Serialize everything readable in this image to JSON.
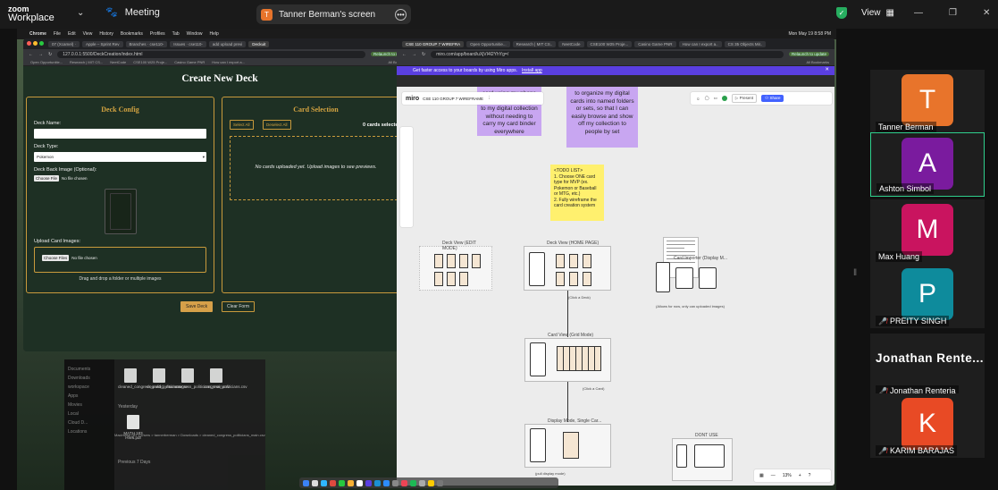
{
  "zoom": {
    "brand_line1": "zoom",
    "brand_line2": "Workplace",
    "meeting_label": "Meeting",
    "screen_share_label": "Tanner Berman's screen",
    "presenter_initial": "T",
    "view_label": "View"
  },
  "mac_menu": [
    "Chrome",
    "File",
    "Edit",
    "View",
    "History",
    "Bookmarks",
    "Profiles",
    "Tab",
    "Window",
    "Help"
  ],
  "mac_clock": "Mon May 19  8:58 PM",
  "chrome_left": {
    "tabs": [
      "07 (Xcamel) ·",
      "Apple – Sprint Rev",
      "Branches · cse110-",
      "Issues · cse110-",
      "add upload previ",
      "Deckuit"
    ],
    "url": "127.0.0.1:5500/DeckCreation/index.html",
    "relaunch": "Relaunch to update",
    "bookmarks": [
      "Open Opportunitie...",
      "Research | MIT CS...",
      "NeetCode",
      "CSE100 W25 Proje...",
      "Casino Game PNR",
      "How can I export a..."
    ],
    "all_bookmarks": "All Bookmarks"
  },
  "deck_app": {
    "title": "Create New Deck",
    "config": {
      "heading": "Deck Config",
      "name_label": "Deck Name:",
      "type_label": "Deck Type:",
      "type_value": "Pokemon",
      "back_label": "Deck Back Image (Optional):",
      "choose_file": "Choose File",
      "no_file": "No file chosen",
      "upload_label": "Upload Card Images:",
      "choose_files": "Choose Files",
      "no_file2": "No file chosen",
      "drop_hint": "Drag and drop a folder or multiple images"
    },
    "selection": {
      "heading": "Card Selection",
      "select_all": "Select All",
      "deselect_all": "Deselect All",
      "count": "0 cards selected",
      "empty": "No cards uploaded yet. Upload images to see previews."
    },
    "save": "Save Deck",
    "clear": "Clear Form"
  },
  "finder": {
    "sidebar": [
      "Documents",
      "Downloads",
      "workspace",
      "Apps",
      "Movies",
      "Local",
      "Cloud D...",
      "Locations"
    ],
    "files": [
      "cleaned_congress_politici_main.csv",
      "cleaned_politicians.csv",
      "congress_politicians_main.csv",
      "congress_politicians.csv"
    ],
    "yesterday": "Yesterday",
    "pdf": "MATH 183 HW6.pdf",
    "path": "Macintosh HD > Users > tannerberman > Downloads > cleaned_congress_politicians_main.csv",
    "prev": "Previous 7 Days"
  },
  "chrome_right": {
    "tabs": [
      "CSE 110 GROUP 7 WIREFRA",
      "Open Opportunitie...",
      "Research | MIT CS..",
      "NeetCode",
      "CSE100 W25 Proje...",
      "Casino Game PNR",
      "How can I export a..",
      "CS 35 Objects Mir.."
    ],
    "url": "miro.com/app/board/uXjVI4l2YhYg=/",
    "relaunch": "Relaunch to update",
    "all_bookmarks": "All Bookmarks",
    "banner": "Get faster access to your boards by using Miro apps.",
    "install": "Install app"
  },
  "miro": {
    "board_name": "CSE 110 GROUP 7 WIREFRAME",
    "logo": "miro",
    "present": "Present",
    "share": "Share",
    "zoom": "13%",
    "sticky1": "card using my phone so I can quickly add it to my digital collection without needing to carry my card binder everywhere",
    "sticky2": "to organize my digital cards into named folders or sets, so that I can easily browse and show off my collection to people by set",
    "todo": "<TODO LIST>\n1. Choose ONE card type for MVP (ex. Pokemon or Baseball or MTG, etc.)\n2. Fully wireframe the card creation system",
    "frames": [
      "Deck View (EDIT MODE)",
      "Deck View (HOME PAGE)",
      "Card Importer (Display M...",
      "Card View (Grid Mode)",
      "Display Mode, Single Car...",
      "DONT USE"
    ],
    "notes": [
      "(Click a Deck)",
      "(Allows for now, only can uploaded images)",
      "(Click a Card)",
      "(pull display mode)"
    ]
  },
  "participants": [
    {
      "initial": "T",
      "name": "Tanner Berman",
      "color": "#e8742b",
      "muted": false
    },
    {
      "initial": "A",
      "name": "Ashton Simbol",
      "color": "#7a1b9e",
      "muted": false
    },
    {
      "initial": "M",
      "name": "Max Huang",
      "color": "#c9145f",
      "muted": false
    },
    {
      "initial": "P",
      "name": "PREITY SINGH",
      "color": "#0e8b9c",
      "muted": true
    },
    {
      "initial": "K",
      "name": "KARIM BARAJAS",
      "color": "#e84a25",
      "muted": true
    }
  ],
  "jonathan": {
    "display": "Jonathan  Rente...",
    "name": "Jonathan Renteria"
  }
}
